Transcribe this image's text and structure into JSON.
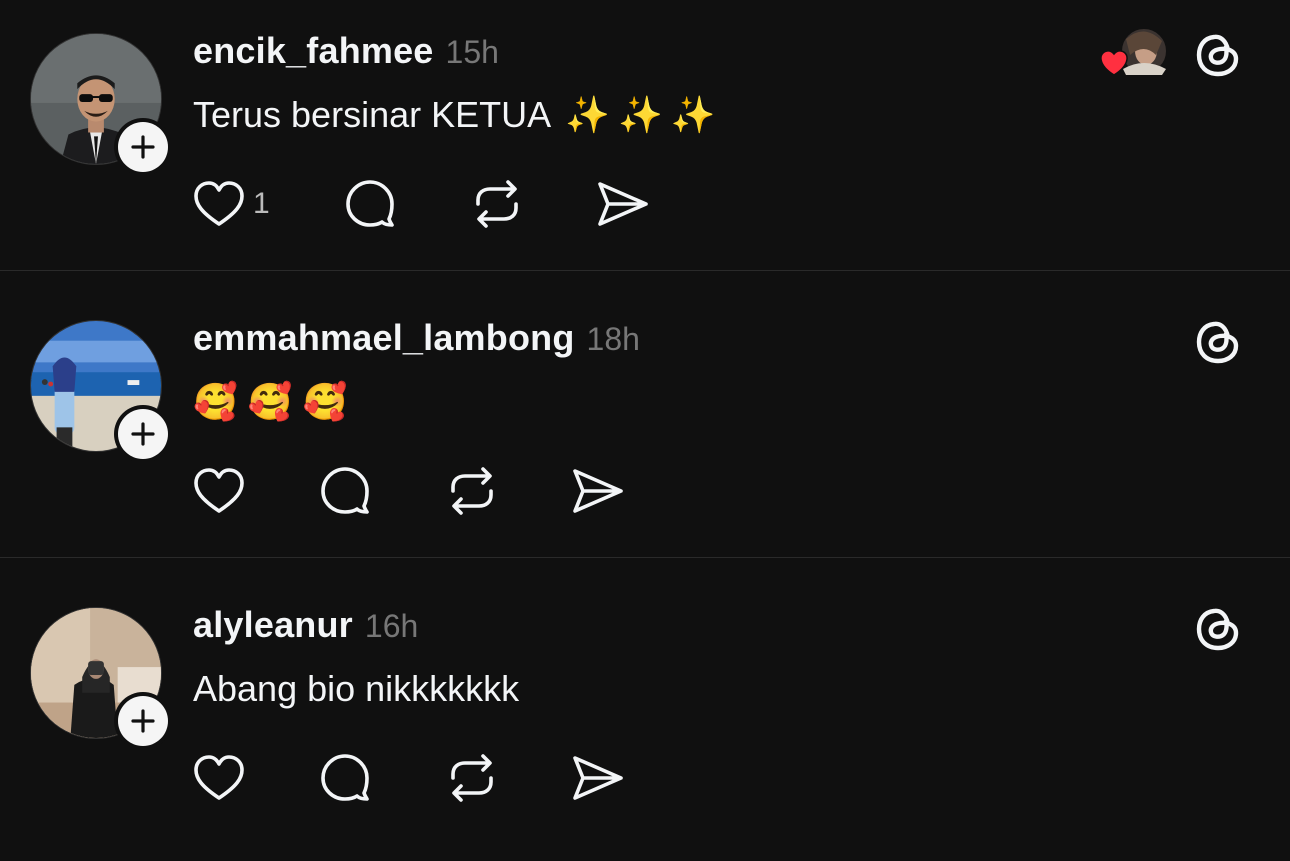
{
  "posts": [
    {
      "username": "encik_fahmee",
      "time": "15h",
      "text": "Terus bersinar KETUA",
      "emojis": [
        "✨",
        "✨",
        "✨"
      ],
      "like_count": "1",
      "liked_by_avatar": true
    },
    {
      "username": "emmahmael_lambong",
      "time": "18h",
      "text": "",
      "emojis": [
        "🥰",
        "🥰",
        "🥰"
      ],
      "like_count": "",
      "liked_by_avatar": false
    },
    {
      "username": "alyleanur",
      "time": "16h",
      "text": "Abang bio nikkkkkkk",
      "emojis": [],
      "like_count": "",
      "liked_by_avatar": false
    }
  ],
  "icons": {
    "like": "heart-icon",
    "comment": "comment-icon",
    "repost": "repost-icon",
    "share": "send-icon",
    "follow": "plus-icon",
    "app": "threads-icon"
  },
  "colors": {
    "background": "#101010",
    "text": "#f3f5f7",
    "muted": "#777777",
    "like_red": "#ff3040"
  }
}
